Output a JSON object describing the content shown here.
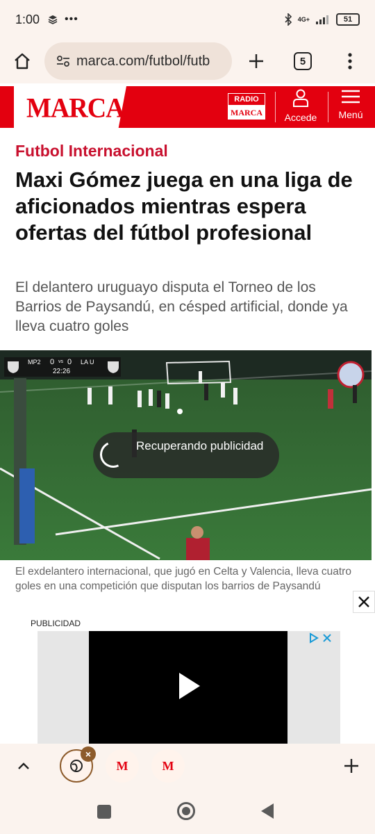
{
  "status_bar": {
    "time": "1:00",
    "network": "4G+",
    "battery": "51"
  },
  "browser": {
    "url": "marca.com/futbol/futb",
    "tab_count": "5"
  },
  "header": {
    "logo": "MARCA",
    "radio_top": "RADIO",
    "radio_bottom": "MARCA",
    "login_label": "Accede",
    "menu_label": "Menú"
  },
  "article": {
    "section": "Futbol Internacional",
    "headline": "Maxi Gómez juega en una liga de aficionados mientras espera ofertas del fútbol profesional",
    "subtitle": "El delantero uruguayo disputa el Torneo de los Barrios de Paysandú, en césped artificial, donde ya lleva cuatro goles",
    "video": {
      "score_team_home": "MP2",
      "score_home": "0",
      "score_vs": "vs",
      "score_away": "0",
      "score_team_away": "LA U",
      "score_clock": "22:26",
      "loading_text": "Recuperando publicidad"
    },
    "caption": "El exdelantero internacional, que jugó en Celta y Valencia, lleva cuatro goles en una competición que disputan los barrios de Paysandú"
  },
  "ad": {
    "label": "PUBLICIDAD"
  },
  "tab_strip": {
    "tab2": "M",
    "tab3": "M"
  }
}
